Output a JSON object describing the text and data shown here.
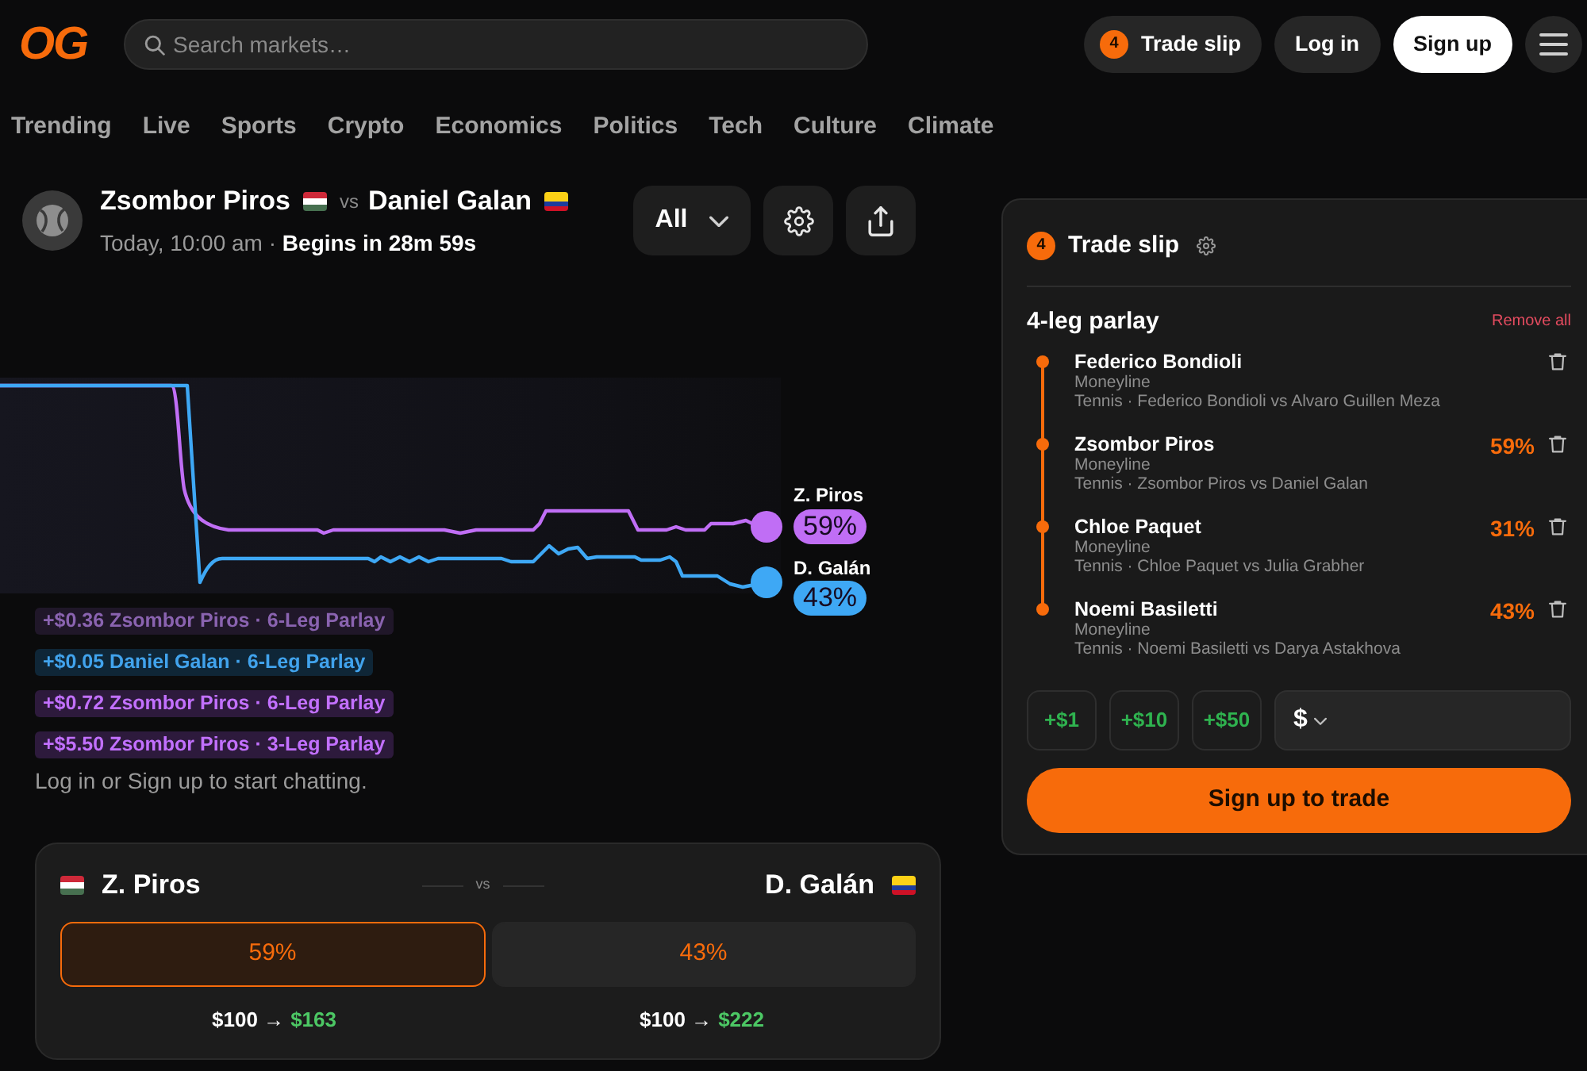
{
  "header": {
    "logo": "OG",
    "search": {
      "placeholder": "Search markets…"
    },
    "trade_slip_button": {
      "count": "4",
      "label": "Trade slip"
    },
    "login_button": "Log in",
    "signup_button": "Sign up"
  },
  "categories": [
    "Trending",
    "Live",
    "Sports",
    "Crypto",
    "Economics",
    "Politics",
    "Tech",
    "Culture",
    "Climate"
  ],
  "match": {
    "players": [
      {
        "name": "Zsombor Piros"
      },
      {
        "name": "Daniel Galan"
      }
    ],
    "vs": "vs",
    "schedule": "Today, 10:00 am · **Begins in 28m 59s**",
    "filter": "All"
  },
  "chart": {
    "series": [
      {
        "name": "Z. Piros",
        "value": "59%",
        "color": "#c06ef5"
      },
      {
        "name": "D. Galán",
        "value": "43%",
        "color": "#3ea8f5"
      }
    ]
  },
  "chat": {
    "messages": [
      {
        "text": "+$0.36 Zsombor Piros · 6-Leg Parlay",
        "color": "#201729"
      },
      {
        "text": "+$0.05 Daniel Galan · 6-Leg Parlay",
        "color": "#0f2637"
      },
      {
        "text": "+$0.72 Zsombor Piros · 6-Leg Parlay",
        "color": "#2d1a3c"
      },
      {
        "text": "+$5.50 Zsombor Piros · 3-Leg Parlay",
        "color": "#2d1a3c"
      }
    ],
    "prompt": "Log in or Sign up to start chatting."
  },
  "market": {
    "vs": "vs",
    "outcomes": [
      {
        "name": "Z. Piros",
        "price": "59%",
        "selected": true,
        "stake": "$100 →",
        "payout": "$163"
      },
      {
        "name": "D. Galán",
        "price": "43%",
        "selected": false,
        "stake": "$100 →",
        "payout": "$222"
      }
    ]
  },
  "trade_slip": {
    "count": "4",
    "title": "Trade slip",
    "parlay_title": "4-leg parlay",
    "remove_all": "Remove all",
    "legs": [
      {
        "name": "Federico Bondioli",
        "market": "Moneyline",
        "event": "Tennis · Federico Bondioli vs Alvaro Guillen Meza"
      },
      {
        "name": "Zsombor Piros",
        "market": "Moneyline",
        "event": "Tennis · Zsombor Piros vs Daniel Galan",
        "price": "59%"
      },
      {
        "name": "Chloe Paquet",
        "market": "Moneyline",
        "event": "Tennis · Chloe Paquet vs Julia Grabher",
        "price": "31%"
      },
      {
        "name": "Noemi Basiletti",
        "market": "Moneyline",
        "event": "Tennis · Noemi Basiletti vs Darya Astakhova",
        "price": "43%"
      }
    ],
    "quick_amounts": [
      "+$1",
      "+$10",
      "+$50"
    ],
    "amount_field": {
      "currency": "$"
    },
    "submit_button": "Sign up to trade"
  }
}
